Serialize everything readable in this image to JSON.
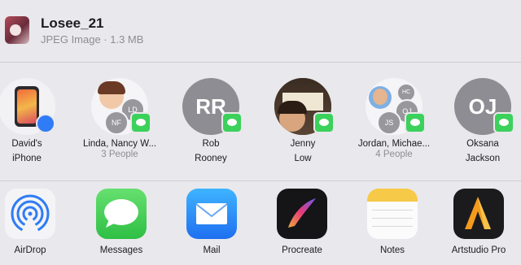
{
  "header": {
    "title": "Losee_21",
    "subtitle": "JPEG Image · 1.3 MB"
  },
  "people": [
    {
      "name": "David's",
      "sub": "iPhone",
      "kind": "device"
    },
    {
      "name": "Linda, Nancy W...",
      "sub": "3 People",
      "kind": "group",
      "bubbles": [
        "LD",
        "NF"
      ]
    },
    {
      "name": "Rob",
      "sub": "Rooney",
      "kind": "initials",
      "initials": "RR"
    },
    {
      "name": "Jenny",
      "sub": "Low",
      "kind": "photo"
    },
    {
      "name": "Jordan, Michae...",
      "sub": "4 People",
      "kind": "group",
      "bubbles": [
        "HC",
        "OJ",
        "JS"
      ]
    },
    {
      "name": "Oksana",
      "sub": "Jackson",
      "kind": "initials",
      "initials": "OJ"
    }
  ],
  "apps": [
    {
      "label": "AirDrop",
      "icon": "airdrop-icon"
    },
    {
      "label": "Messages",
      "icon": "messages-icon"
    },
    {
      "label": "Mail",
      "icon": "mail-icon"
    },
    {
      "label": "Procreate",
      "icon": "procreate-icon"
    },
    {
      "label": "Notes",
      "icon": "notes-icon"
    },
    {
      "label": "Artstudio Pro",
      "icon": "artstudio-icon"
    }
  ],
  "colors": {
    "messages_green": "#3bd15b",
    "airdrop_blue": "#2f7cf6",
    "mail_blue": "#2e8ef5"
  }
}
